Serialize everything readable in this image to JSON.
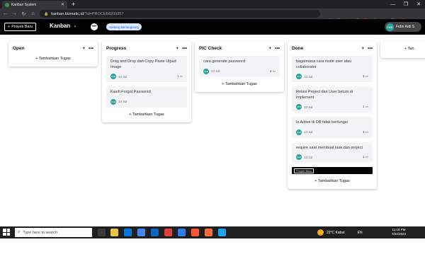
{
  "browser": {
    "tab_title": "Kanban System",
    "url_host": "kanban.bizmatic.id",
    "url_path": "/?id=PROCEB6209857",
    "lock": "lock-icon"
  },
  "header": {
    "new_project_label": "Proyek Baru",
    "app_name": "Kanban",
    "status_label": "Sedang Berlangsung",
    "user_initials": "FAR",
    "user_name": "Febri Ardi S"
  },
  "columns": [
    {
      "title": "Open",
      "cards": [],
      "add_label": "Tambahkan Tugas"
    },
    {
      "title": "Progress",
      "cards": [
        {
          "title": "Drag and Drop dan Copy Paste Ulpad Image",
          "initials": "FAR",
          "date": "14 Jul",
          "count": "1"
        },
        {
          "title": "Kasih Forgot Password",
          "initials": "FAR",
          "date": "14 Jul",
          "count": ""
        }
      ],
      "add_label": "Tambahkan Tugas"
    },
    {
      "title": "PIC Check",
      "cards": [
        {
          "title": "cara generate password",
          "initials": "FAR",
          "date": "14 Jul",
          "count": "6"
        }
      ],
      "add_label": "Tambahkan Tugas"
    },
    {
      "title": "Done",
      "cards": [
        {
          "title": "bagaimana cara invite user atau collaborator",
          "initials": "FAR",
          "date": "13 Jul",
          "count": "1"
        },
        {
          "title": "Relasi Project dan User belum di implement",
          "initials": "FAR",
          "date": "13 Jul",
          "count": "1"
        },
        {
          "title": "Is Active di DB tidak berfungsi",
          "initials": "FAR",
          "date": "13 Jul",
          "count": "1"
        },
        {
          "title": "require saat membuat task dan project",
          "initials": "FAR",
          "date": "13 Jul",
          "count": "1"
        }
      ],
      "add_label": "Tambahkan Tugas",
      "overlay_label": "Proyek Baru"
    }
  ],
  "partial_column_label": "+ Tan",
  "taskbar": {
    "search_placeholder": "Type here to search",
    "weather": "22°C  Kabut",
    "lang": "EN",
    "time": "11:16 PM",
    "date": "7/24/2023"
  }
}
